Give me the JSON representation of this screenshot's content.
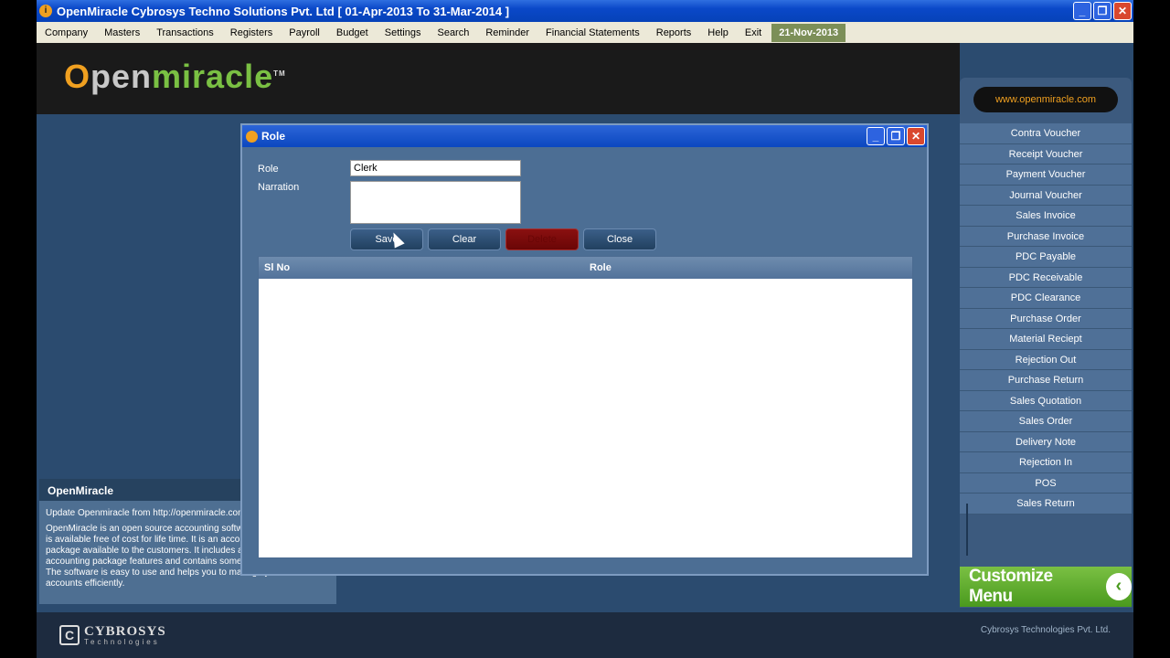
{
  "window": {
    "title": "OpenMiracle Cybrosys Techno Solutions Pvt. Ltd [ 01-Apr-2013 To 31-Mar-2014 ]",
    "controls": {
      "minimize": "_",
      "restore": "❐",
      "close": "✕"
    }
  },
  "menubar": {
    "items": [
      "Company",
      "Masters",
      "Transactions",
      "Registers",
      "Payroll",
      "Budget",
      "Settings",
      "Search",
      "Reminder",
      "Financial Statements",
      "Reports",
      "Help",
      "Exit"
    ],
    "date": "21-Nov-2013"
  },
  "logo": {
    "o": "O",
    "pen": "pen",
    "miracle": "miracle",
    "tm": "TM"
  },
  "openmiracle_panel": {
    "heading": "OpenMiracle",
    "update_text": "Update Openmiracle from http://openmiracle.com",
    "description": "OpenMiracle is an open source accounting software. The source code is available free of cost for life time. It is an accounting software package available to the customers. It includes all the traditional accounting package features and contains some additional features. The software is easy to use and helps you to manage your business accounts efficiently."
  },
  "sidebar": {
    "url": "www.openmiracle.com",
    "items": [
      "Contra Voucher",
      "Receipt Voucher",
      "Payment Voucher",
      "Journal Voucher",
      "Sales Invoice",
      "Purchase Invoice",
      "PDC Payable",
      "PDC Receivable",
      "PDC Clearance",
      "Purchase Order",
      "Material Reciept",
      "Rejection Out",
      "Purchase Return",
      "Sales Quotation",
      "Sales Order",
      "Delivery Note",
      "Rejection In",
      "POS",
      "Sales Return"
    ],
    "customize_label": "Customize Menu",
    "customize_icon": "chevron-left-icon"
  },
  "dialog": {
    "title": "Role",
    "role_label": "Role",
    "role_value": "Clerk",
    "narration_label": "Narration",
    "narration_value": "",
    "buttons": {
      "save": "Save",
      "clear": "Clear",
      "delete": "Delete",
      "close": "Close"
    },
    "grid": {
      "columns": [
        "Sl No",
        "Role"
      ],
      "rows": []
    }
  },
  "footer": {
    "brand": "CYBROSYS",
    "brand_sub": "Technologies",
    "right_text": "Cybrosys Technologies Pvt. Ltd."
  },
  "colors": {
    "titlebar": "#0a48c8",
    "main_bg": "#2b4b6f",
    "accent_green": "#7ac043",
    "accent_orange": "#f0a020",
    "delete_red": "#8a1010"
  }
}
